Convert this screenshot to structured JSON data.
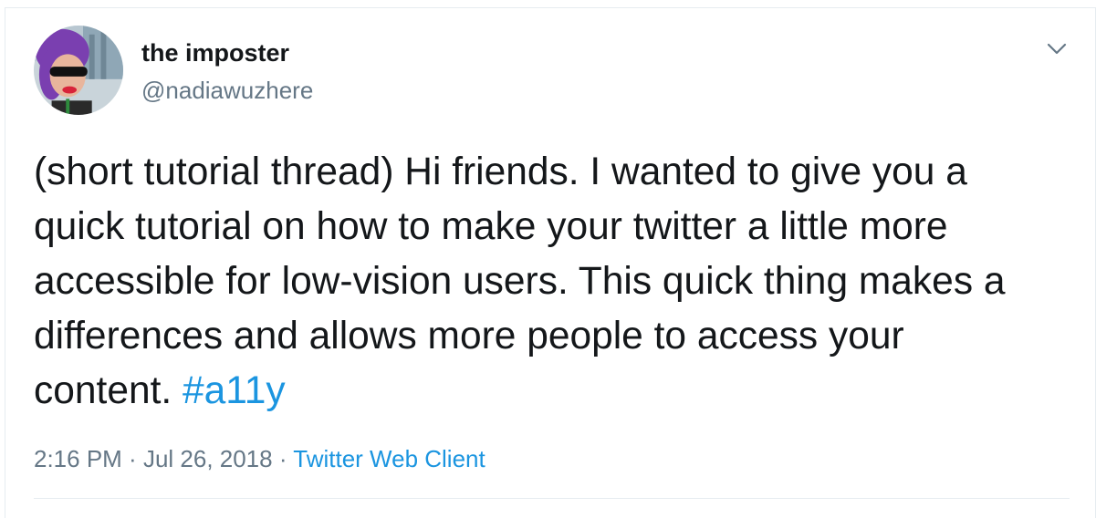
{
  "tweet": {
    "author": {
      "display_name": "the imposter",
      "handle": "@nadiawuzhere",
      "avatar_icon": "profile-photo"
    },
    "menu_icon": "chevron-down-icon",
    "text_lines": [
      "(short tutorial thread) Hi friends. I wanted to give you a",
      "quick tutorial on how to make your twitter a little more",
      "accessible for low-vision users. This quick thing makes a",
      "differences and allows more people to access your"
    ],
    "last_line_text": "content. ",
    "hashtag": "#a11y",
    "time": "2:16 PM",
    "separator": " · ",
    "date": "Jul 26, 2018",
    "source": "Twitter Web Client"
  },
  "colors": {
    "text": "#14171a",
    "secondary": "#657786",
    "link": "#1b95e0",
    "border": "#e6ecf0"
  }
}
